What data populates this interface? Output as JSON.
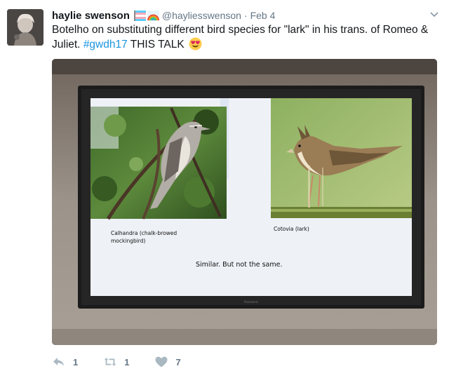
{
  "tweet": {
    "display_name": "haylie swenson",
    "handle": "@hayliesswenson",
    "separator": "·",
    "date": "Feb 4",
    "text_before_hashtag": "Botelho on substituting different bird species for \"lark\" in his trans. of Romeo & Juliet.",
    "hashtag": "#gwdh17",
    "text_after_hashtag": "THIS TALK",
    "emoji": "heart-eyes-emoji",
    "badges": [
      "trans-flag-emoji",
      "rainbow-emoji"
    ]
  },
  "slide": {
    "left_caption_line1": "Calhandra (chalk-browed",
    "left_caption_line2": "mockingbird)",
    "right_caption": "Cotovia (lark)",
    "bottom_text": "Similar. But not the same.",
    "tv_brand": "Panasonic"
  },
  "actions": {
    "reply_count": "1",
    "retweet_count": "1",
    "like_count": "7"
  },
  "colors": {
    "link": "#1b95e0",
    "muted": "#657786",
    "text": "#14171a"
  }
}
